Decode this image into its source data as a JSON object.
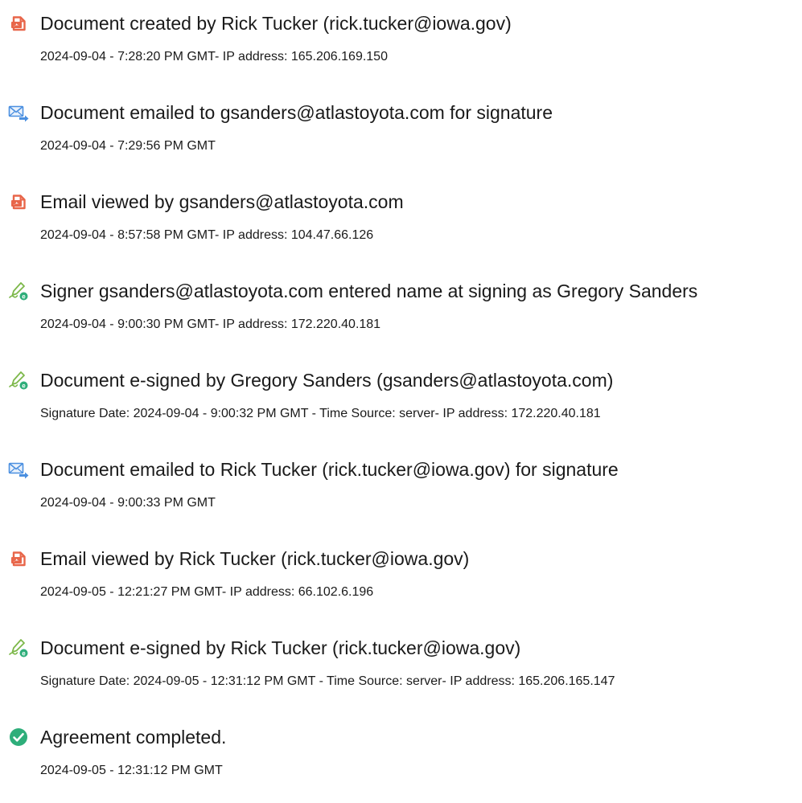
{
  "colors": {
    "document_icon": "#e8664a",
    "email_icon": "#4a8fe0",
    "sign_icon": "#7db84a",
    "complete_icon": "#2eae7a",
    "text": "#1a1a1a"
  },
  "events": [
    {
      "icon": "document-icon",
      "title": "Document created by Rick Tucker (rick.tucker@iowa.gov)",
      "detail": "2024-09-04 - 7:28:20 PM GMT- IP address: 165.206.169.150"
    },
    {
      "icon": "email-icon",
      "title": "Document emailed to gsanders@atlastoyota.com for signature",
      "detail": "2024-09-04 - 7:29:56 PM GMT"
    },
    {
      "icon": "document-icon",
      "title": "Email viewed by gsanders@atlastoyota.com",
      "detail": "2024-09-04 - 8:57:58 PM GMT- IP address: 104.47.66.126"
    },
    {
      "icon": "signature-icon",
      "title": "Signer gsanders@atlastoyota.com entered name at signing as Gregory Sanders",
      "detail": "2024-09-04 - 9:00:30 PM GMT- IP address: 172.220.40.181"
    },
    {
      "icon": "signature-icon",
      "title": "Document e-signed by Gregory Sanders (gsanders@atlastoyota.com)",
      "detail": "Signature Date: 2024-09-04 - 9:00:32 PM GMT - Time Source: server- IP address: 172.220.40.181"
    },
    {
      "icon": "email-icon",
      "title": "Document emailed to Rick Tucker (rick.tucker@iowa.gov) for signature",
      "detail": "2024-09-04 - 9:00:33 PM GMT"
    },
    {
      "icon": "document-icon",
      "title": "Email viewed by Rick Tucker (rick.tucker@iowa.gov)",
      "detail": "2024-09-05 - 12:21:27 PM GMT- IP address: 66.102.6.196"
    },
    {
      "icon": "signature-icon",
      "title": "Document e-signed by Rick Tucker (rick.tucker@iowa.gov)",
      "detail": "Signature Date: 2024-09-05 - 12:31:12 PM GMT - Time Source: server- IP address: 165.206.165.147"
    },
    {
      "icon": "checkmark-icon",
      "title": "Agreement completed.",
      "detail": "2024-09-05 - 12:31:12 PM GMT"
    }
  ]
}
